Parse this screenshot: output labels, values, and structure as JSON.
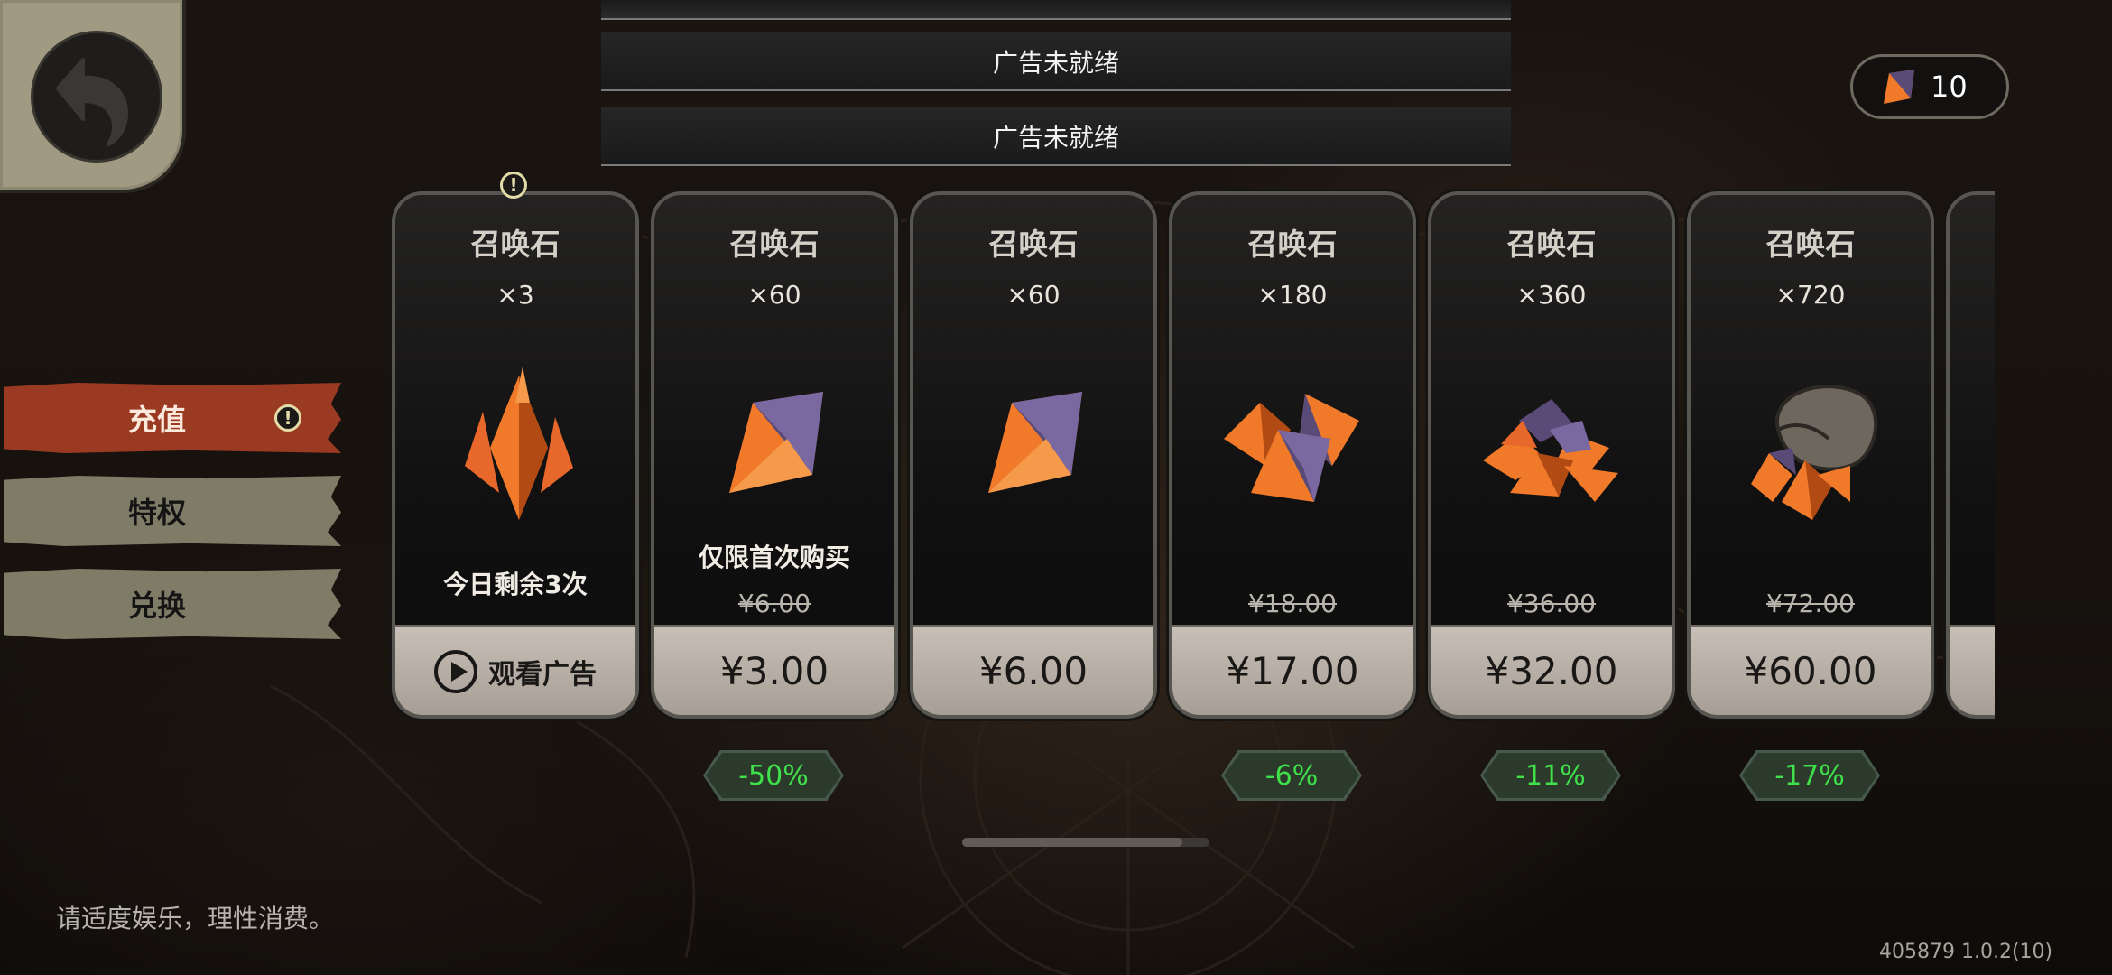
{
  "ads": [
    "广告未就绪",
    "广告未就绪"
  ],
  "currency": {
    "icon": "summon-stone-icon",
    "amount": "10"
  },
  "tabs": [
    {
      "label": "充值",
      "active": true,
      "alert": "!"
    },
    {
      "label": "特权",
      "active": false
    },
    {
      "label": "兑换",
      "active": false
    }
  ],
  "cards": [
    {
      "title": "召唤石",
      "qty": "×3",
      "note": "今日剩余3次",
      "action": "观看广告",
      "alert": "!"
    },
    {
      "title": "召唤石",
      "qty": "×60",
      "note": "仅限首次购买",
      "original_price": "¥6.00",
      "price": "¥3.00",
      "discount": "-50%"
    },
    {
      "title": "召唤石",
      "qty": "×60",
      "price": "¥6.00"
    },
    {
      "title": "召唤石",
      "qty": "×180",
      "original_price": "¥18.00",
      "price": "¥17.00",
      "discount": "-6%"
    },
    {
      "title": "召唤石",
      "qty": "×360",
      "original_price": "¥36.00",
      "price": "¥32.00",
      "discount": "-11%"
    },
    {
      "title": "召唤石",
      "qty": "×720",
      "original_price": "¥72.00",
      "price": "¥60.00",
      "discount": "-17%"
    }
  ],
  "footer_note": "请适度娱乐，理性消费。",
  "version": "405879 1.0.2(10)",
  "colors": {
    "active_tab": "#9a3a22",
    "inactive_tab": "#7e7b66",
    "discount_text": "#3fe04a",
    "gem_orange": "#f07a2a",
    "gem_purple": "#5a4a78"
  }
}
